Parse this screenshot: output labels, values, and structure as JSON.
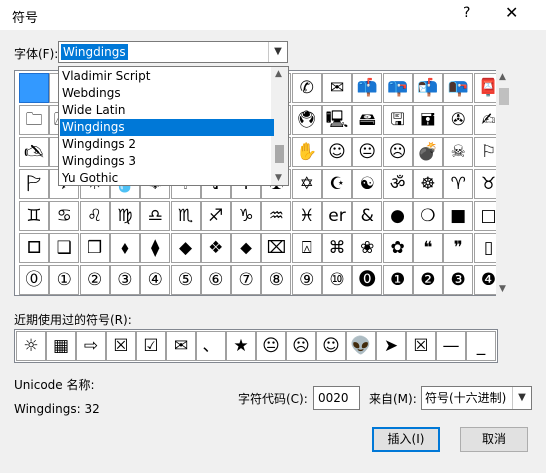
{
  "title": "符号",
  "title_buttons": {
    "help": "?",
    "close": "✕"
  },
  "font_label": "字体(F):",
  "font_value": "Wingdings",
  "font_list": [
    "Vladimir Script",
    "Webdings",
    "Wide Latin",
    "Wingdings",
    "Wingdings 2",
    "Wingdings 3",
    "Yu Gothic"
  ],
  "font_list_selected": 3,
  "symbol_rows": [
    [
      "",
      "✎",
      "✂",
      "✁",
      "👓",
      "🕭",
      "🕮",
      "🕯",
      "🕿",
      "✆",
      "✉",
      "📫",
      "📪",
      "📬",
      "📭",
      "📮"
    ],
    [
      "🗀",
      "🗁",
      "🗎",
      "🗏",
      "🗐",
      "🗄",
      "⏳",
      "🖮",
      "🖰",
      "🖲",
      "🖳",
      "🖴",
      "🖫",
      "🖬",
      "✇",
      "✍"
    ],
    [
      "🖎",
      "✌",
      "👌",
      "👍",
      "👎",
      "☜",
      "☞",
      "☝",
      "☟",
      "✋",
      "☺",
      "😐",
      "☹",
      "💣",
      "☠",
      "⚐"
    ],
    [
      "🏱",
      "✈",
      "☼",
      "💧",
      "❄",
      "🕆",
      "✞",
      "🕈",
      "✠",
      "✡",
      "☪",
      "☯",
      "ॐ",
      "☸",
      "♈",
      "♉"
    ],
    [
      "♊",
      "♋",
      "♌",
      "♍",
      "♎",
      "♏",
      "♐",
      "♑",
      "♒",
      "♓",
      "er",
      "&",
      "●",
      "❍",
      "■",
      "□"
    ],
    [
      "🞐",
      "❑",
      "❒",
      "⬧",
      "⧫",
      "◆",
      "❖",
      "⬥",
      "⌧",
      "⍓",
      "⌘",
      "❀",
      "✿",
      "❝",
      "❞",
      "▯"
    ],
    [
      "⓪",
      "①",
      "②",
      "③",
      "④",
      "⑤",
      "⑥",
      "⑦",
      "⑧",
      "⑨",
      "⑩",
      "⓿",
      "❶",
      "❷",
      "❸",
      "❹"
    ]
  ],
  "recent_label": "近期使用过的符号(R):",
  "recent_symbols": [
    "☼",
    "▦",
    "⇨",
    "☒",
    "☑",
    "✉",
    "、",
    "★",
    "😐",
    "☹",
    "☺",
    "👽",
    "➤",
    "☒",
    "—",
    "_"
  ],
  "unicode_name_label": "Unicode 名称:",
  "char_name": "Wingdings: 32",
  "char_code_label": "字符代码(C):",
  "char_code_value": "0020",
  "from_label": "来自(M):",
  "from_value": "符号(十六进制)",
  "buttons": {
    "insert": "插入(I)",
    "cancel": "取消"
  }
}
